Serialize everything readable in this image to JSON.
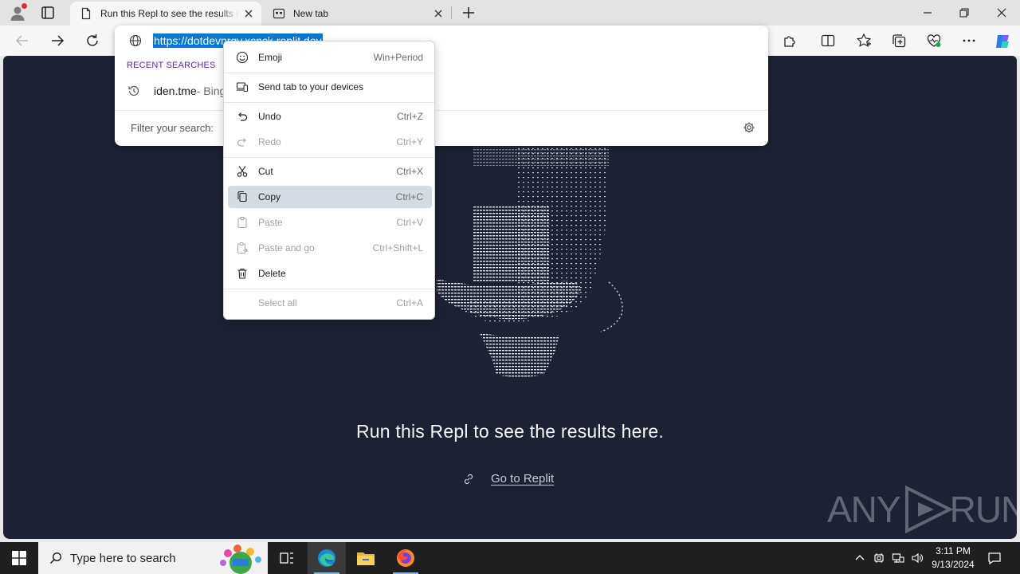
{
  "browser": {
    "tabs": [
      {
        "title": "Run this Repl to see the results here.",
        "active": true
      },
      {
        "title": "New tab",
        "active": false
      }
    ],
    "address": {
      "url": "https://dotdevnrgy.xcnck.replit.dev",
      "recent_searches_label": "RECENT SEARCHES",
      "recent_items": [
        {
          "query": "iden.tme",
          "suffix": " - Bing"
        }
      ],
      "filter_placeholder": "Filter your search:"
    },
    "icons": {
      "back": "back-arrow-icon",
      "forward": "forward-arrow-icon",
      "refresh": "refresh-icon",
      "site_info": "globe-icon",
      "extensions": "puzzle-icon",
      "split_screen": "split-screen-icon",
      "favorites": "star-icon",
      "collections": "collections-icon",
      "browser_essentials": "heart-pulse-icon",
      "menu": "ellipsis-icon",
      "copilot": "copilot-icon"
    }
  },
  "context_menu": {
    "items": [
      {
        "label": "Emoji",
        "shortcut": "Win+Period",
        "icon": "emoji-icon",
        "enabled": true
      },
      {
        "label": "Send tab to your devices",
        "shortcut": "",
        "icon": "devices-icon",
        "enabled": true
      },
      {
        "label": "Undo",
        "shortcut": "Ctrl+Z",
        "icon": "undo-icon",
        "enabled": true
      },
      {
        "label": "Redo",
        "shortcut": "Ctrl+Y",
        "icon": "redo-icon",
        "enabled": false
      },
      {
        "label": "Cut",
        "shortcut": "Ctrl+X",
        "icon": "scissors-icon",
        "enabled": true
      },
      {
        "label": "Copy",
        "shortcut": "Ctrl+C",
        "icon": "copy-icon",
        "enabled": true,
        "highlighted": true
      },
      {
        "label": "Paste",
        "shortcut": "Ctrl+V",
        "icon": "paste-icon",
        "enabled": false
      },
      {
        "label": "Paste and go",
        "shortcut": "Ctrl+Shift+L",
        "icon": "paste-go-icon",
        "enabled": false
      },
      {
        "label": "Delete",
        "shortcut": "",
        "icon": "trash-icon",
        "enabled": true
      },
      {
        "label": "Select all",
        "shortcut": "Ctrl+A",
        "icon": "",
        "enabled": false
      }
    ]
  },
  "page": {
    "message": "Run this Repl to see the results here.",
    "link_text": "Go to Replit",
    "watermark": {
      "left": "ANY",
      "right": "RUN"
    }
  },
  "taskbar": {
    "search_placeholder": "Type here to search",
    "apps": [
      "task-view-icon",
      "edge-icon",
      "file-explorer-icon",
      "firefox-icon"
    ],
    "clock_time": "3:11 PM",
    "clock_date": "9/13/2024"
  },
  "colors": {
    "accent": "#0078d4",
    "page_background": "#1c2233",
    "taskbar": "#1f1f1f",
    "menu_highlight": "#d5dbe3"
  }
}
